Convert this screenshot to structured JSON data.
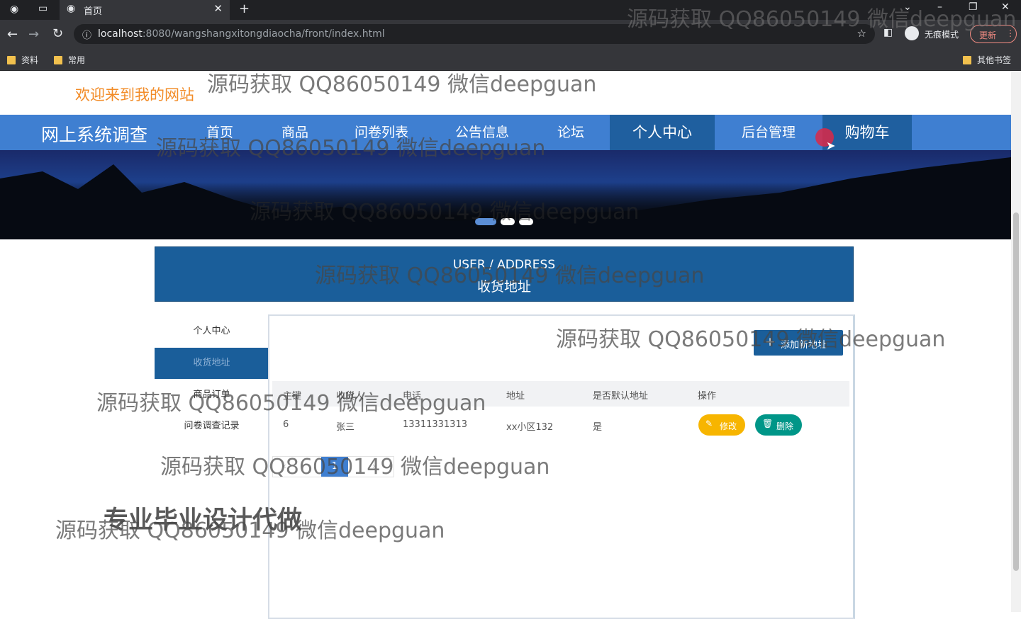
{
  "browser": {
    "tab_title": "首页",
    "new_tab": "+",
    "url_host": "localhost",
    "url_rest": ":8080/wangshangxitongdiaocha/front/index.html",
    "incognito_label": "无痕模式",
    "update_label": "更新",
    "bookmarks": [
      "资料",
      "常用"
    ],
    "other_bookmarks": "其他书签"
  },
  "site": {
    "welcome": "欢迎来到我的网站",
    "brand": "网上系统调查",
    "nav": [
      "首页",
      "商品",
      "问卷列表",
      "公告信息",
      "论坛",
      "个人中心",
      "后台管理",
      "购物车"
    ],
    "active_nav": "个人中心"
  },
  "carousel": {
    "dots": 3,
    "active_index": 0
  },
  "banner": {
    "en": "USER / ADDRESS",
    "cn": "收货地址"
  },
  "sidebar": {
    "items": [
      {
        "label": "个人中心"
      },
      {
        "label": "收货地址"
      },
      {
        "label": "商品订单"
      },
      {
        "label": "问卷调查记录"
      }
    ],
    "active_index": 1
  },
  "toolbar": {
    "add_label": "添加新地址"
  },
  "table": {
    "headers": [
      "主键",
      "收货人",
      "电话",
      "地址",
      "是否默认地址",
      "操作"
    ],
    "rows": [
      {
        "id": "6",
        "name": "张三",
        "phone": "13311331313",
        "address": "xx小区132",
        "default": "是"
      }
    ],
    "edit_label": "修改",
    "delete_label": "删除"
  },
  "pager": {
    "current": "1"
  },
  "watermarks": [
    "源码获取 QQ86050149 微信deepguan",
    "专业毕业设计代做"
  ]
}
